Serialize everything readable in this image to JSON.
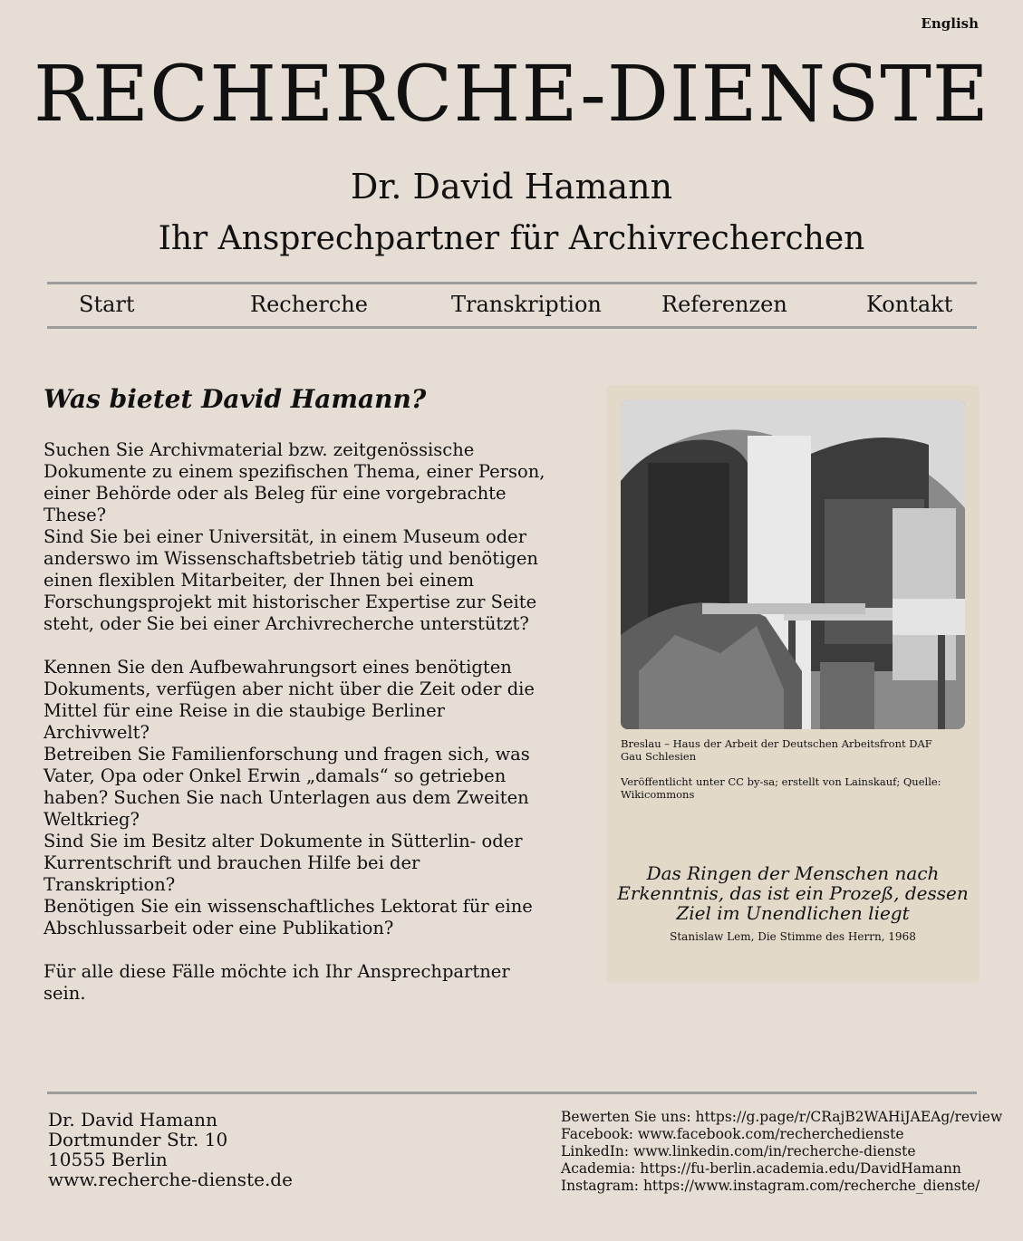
{
  "header": {
    "lang_link": "English",
    "title": "RECHERCHE-DIENSTE",
    "name": "Dr. David Hamann",
    "tagline": "Ihr Ansprechpartner für Archivrecherchen"
  },
  "nav": {
    "items": [
      {
        "label": "Start"
      },
      {
        "label": "Recherche"
      },
      {
        "label": "Transkription"
      },
      {
        "label": "Referenzen"
      },
      {
        "label": "Kontakt"
      }
    ]
  },
  "main": {
    "heading": "Was bietet David Hamann?",
    "paragraphs": [
      "Suchen Sie Archivmaterial bzw. zeitgenössische Dokumente zu einem spezifischen Thema, einer Person, einer Behörde oder als Beleg für eine vorgebrachte These?",
      "Sind Sie bei einer Universität, in einem Museum oder anderswo im Wissenschaftsbetrieb tätig und benötigen einen flexiblen Mitarbeiter, der Ihnen bei einem Forschungsprojekt mit historischer Expertise zur Seite steht, oder Sie bei einer Archivrecherche unterstützt?",
      "Kennen Sie den Aufbewahrungsort eines benötigten Dokuments, verfügen aber nicht über die Zeit oder die Mittel für eine Reise in die staubige Berliner Archivwelt?",
      "Betreiben Sie Familienforschung und fragen sich, was Vater, Opa oder Onkel Erwin „damals“ so getrieben haben? Suchen Sie nach Unterlagen aus dem Zweiten Weltkrieg?",
      "Sind Sie im Besitz alter Dokumente in Sütterlin- oder Kurrentschrift und brauchen Hilfe bei der Transkription?",
      "Benötigen Sie ein wissenschaftliches Lektorat für eine Abschlussarbeit oder eine Publikation?",
      "Für alle diese Fälle möchte ich Ihr Ansprechpartner sein."
    ]
  },
  "aside": {
    "caption": "Breslau – Haus der Arbeit der Deutschen Arbeitsfront DAF Gau Schlesien",
    "credit": "Veröffentlicht unter CC by-sa; erstellt von Lainskauf; Quelle: Wikicommons",
    "quote": "Das Ringen der Menschen nach Erkenntnis, das ist ein Prozeß, dessen Ziel im Unendlichen liegt",
    "quote_source": "Stanislaw Lem, Die Stimme des Herrn, 1968"
  },
  "footer": {
    "address": [
      "Dr. David Hamann",
      "Dortmunder Str. 10",
      "10555 Berlin",
      "www.recherche-dienste.de"
    ],
    "links": [
      "Bewerten Sie uns: https://g.page/r/CRajB2WAHiJAEAg/review",
      "Facebook: www.facebook.com/recherchedienste",
      "LinkedIn: www.linkedin.com/in/recherche-dienste",
      "Academia: https://fu-berlin.academia.edu/DavidHamann",
      "Instagram: https://www.instagram.com/recherche_dienste/"
    ]
  }
}
